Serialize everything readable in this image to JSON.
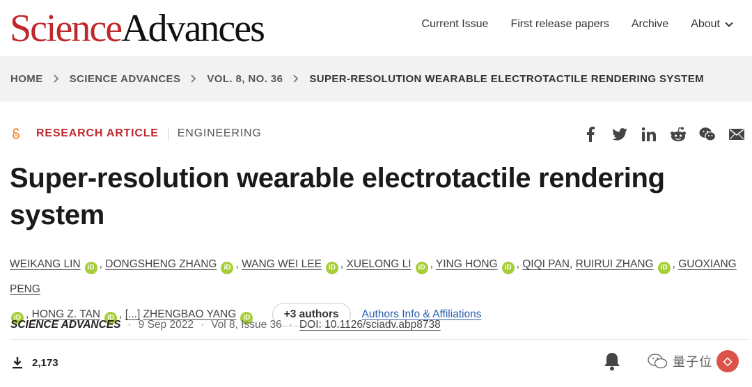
{
  "header": {
    "logo_part1": "Science",
    "logo_part2": "Advances",
    "nav": [
      {
        "label": "Current Issue"
      },
      {
        "label": "First release papers"
      },
      {
        "label": "Archive"
      },
      {
        "label": "About",
        "icon": "chevron-down-icon"
      }
    ]
  },
  "breadcrumb": [
    "HOME",
    "SCIENCE ADVANCES",
    "VOL. 8, NO. 36",
    "SUPER-RESOLUTION WEARABLE ELECTROTACTILE RENDERING SYSTEM"
  ],
  "article": {
    "open_access_icon": "open-access-lock-icon",
    "type": "RESEARCH ARTICLE",
    "subject": "ENGINEERING",
    "share_icons": [
      "facebook-icon",
      "twitter-icon",
      "linkedin-icon",
      "reddit-icon",
      "wechat-icon",
      "email-icon"
    ],
    "title": "Super-resolution wearable electrotactile rendering system",
    "authors": [
      {
        "name": "WEIKANG LIN",
        "orcid": true
      },
      {
        "name": "DONGSHENG ZHANG",
        "orcid": true
      },
      {
        "name": "WANG WEI LEE",
        "orcid": true
      },
      {
        "name": "XUELONG LI",
        "orcid": true
      },
      {
        "name": "YING HONG",
        "orcid": true
      },
      {
        "name": "QIQI PAN",
        "orcid": false
      },
      {
        "name": "RUIRUI ZHANG",
        "orcid": true
      },
      {
        "name": "GUOXIANG PENG",
        "orcid": true
      },
      {
        "name": "HONG Z. TAN",
        "orcid": true
      },
      {
        "name": "ZHENGBAO YANG",
        "orcid": true
      }
    ],
    "ellipsis": "[...]",
    "more_authors_button": "+3 authors",
    "affiliations_link": "Authors Info & Affiliations",
    "orcid_label": "iD",
    "journal": "SCIENCE ADVANCES",
    "date": "9 Sep 2022",
    "volume": "Vol 8, Issue 36",
    "doi": "DOI: 10.1126/sciadv.abp8738",
    "downloads": "2,173",
    "download_icon": "download-icon",
    "bell_icon": "bell-icon",
    "bookmark_icon": "bookmark-icon"
  },
  "watermark": {
    "text": "量子位"
  }
}
